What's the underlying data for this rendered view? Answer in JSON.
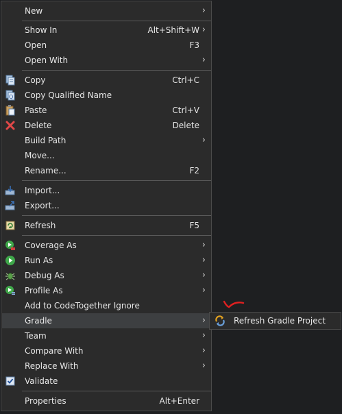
{
  "menu": {
    "items": [
      {
        "label": "New",
        "arrow": "›"
      },
      {
        "label": "Show In",
        "shortcut": "Alt+Shift+W",
        "arrow": "›"
      },
      {
        "label": "Open",
        "shortcut": "F3"
      },
      {
        "label": "Open With",
        "arrow": "›"
      },
      {
        "label": "Copy",
        "shortcut": "Ctrl+C",
        "icon": "copy-icon"
      },
      {
        "label": "Copy Qualified Name",
        "icon": "copy-qualified-name-icon"
      },
      {
        "label": "Paste",
        "shortcut": "Ctrl+V",
        "icon": "paste-icon"
      },
      {
        "label": "Delete",
        "shortcut": "Delete",
        "icon": "delete-icon"
      },
      {
        "label": "Build Path",
        "arrow": "›"
      },
      {
        "label": "Move..."
      },
      {
        "label": "Rename...",
        "shortcut": "F2"
      },
      {
        "label": "Import...",
        "icon": "import-icon"
      },
      {
        "label": "Export...",
        "icon": "export-icon"
      },
      {
        "label": "Refresh",
        "shortcut": "F5",
        "icon": "refresh-icon"
      },
      {
        "label": "Coverage As",
        "arrow": "›",
        "icon": "coverage-icon"
      },
      {
        "label": "Run As",
        "arrow": "›",
        "icon": "run-icon"
      },
      {
        "label": "Debug As",
        "arrow": "›",
        "icon": "debug-icon"
      },
      {
        "label": "Profile As",
        "arrow": "›",
        "icon": "profile-icon"
      },
      {
        "label": "Add to CodeTogether Ignore"
      },
      {
        "label": "Gradle",
        "arrow": "›"
      },
      {
        "label": "Team",
        "arrow": "›"
      },
      {
        "label": "Compare With",
        "arrow": "›"
      },
      {
        "label": "Replace With",
        "arrow": "›"
      },
      {
        "label": "Validate",
        "icon": "validate-checkbox-icon"
      },
      {
        "label": "Properties",
        "shortcut": "Alt+Enter"
      }
    ]
  },
  "gradle_submenu": {
    "items": [
      {
        "label": "Refresh Gradle Project",
        "icon": "refresh-gradle-icon"
      }
    ]
  },
  "annotation": {
    "icon": "red-check-mark",
    "color": "#e02020"
  },
  "colors": {
    "menu_bg": "#2b2b2b",
    "hover_bg": "#3d3f41",
    "text": "#e6e6e6",
    "separator": "#5a5a5a",
    "background": "#1e1f21"
  }
}
